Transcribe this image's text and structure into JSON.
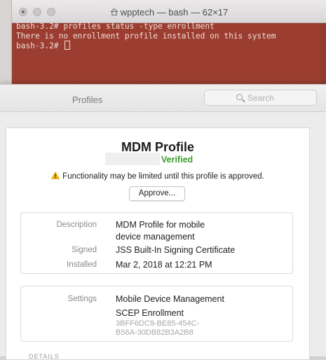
{
  "terminal": {
    "title": "wpptech — bash — 62×17",
    "lines": [
      "bash-3.2# profiles status -type enrollment",
      "There is no enrollment profile installed on this system",
      "bash-3.2# "
    ]
  },
  "profiles_window": {
    "title": "Profiles",
    "search_placeholder": "Search",
    "profile": {
      "name": "MDM Profile",
      "status": "Verified",
      "warning": "Functionality may be limited until this profile is approved.",
      "approve_label": "Approve..."
    },
    "details": {
      "description_label": "Description",
      "description_line1": "MDM Profile for mobile",
      "description_line2": "device management",
      "signed_label": "Signed",
      "signed_value": "JSS Built-In Signing Certificate",
      "installed_label": "Installed",
      "installed_value": "Mar 2, 2018 at 12:21 PM"
    },
    "settings": {
      "label": "Settings",
      "item1": "Mobile Device Management",
      "item2": "SCEP Enrollment",
      "id_line1": "3BFF6DC9-BE85-454C-",
      "id_line2": "B56A-30DB82B3A2B8"
    },
    "section_footer": "DETAILS"
  },
  "colors": {
    "terminal_bg": "#9b3e31",
    "verified": "#3d9c2a",
    "warning_icon": "#f2b705"
  }
}
